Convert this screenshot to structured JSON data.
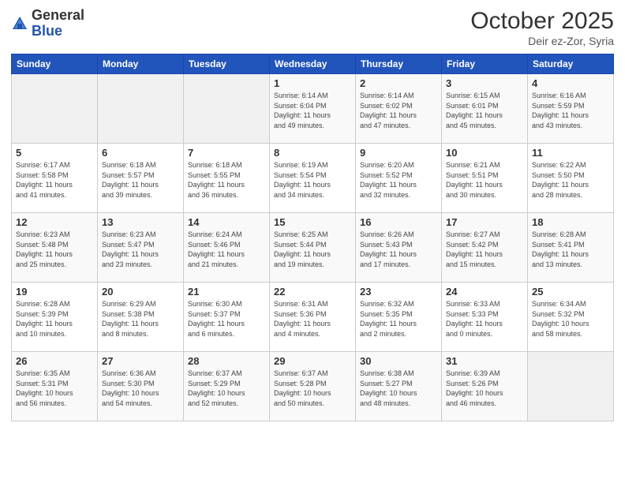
{
  "logo": {
    "general": "General",
    "blue": "Blue"
  },
  "header": {
    "month": "October 2025",
    "location": "Deir ez-Zor, Syria"
  },
  "weekdays": [
    "Sunday",
    "Monday",
    "Tuesday",
    "Wednesday",
    "Thursday",
    "Friday",
    "Saturday"
  ],
  "weeks": [
    [
      {
        "day": "",
        "info": ""
      },
      {
        "day": "",
        "info": ""
      },
      {
        "day": "",
        "info": ""
      },
      {
        "day": "1",
        "info": "Sunrise: 6:14 AM\nSunset: 6:04 PM\nDaylight: 11 hours\nand 49 minutes."
      },
      {
        "day": "2",
        "info": "Sunrise: 6:14 AM\nSunset: 6:02 PM\nDaylight: 11 hours\nand 47 minutes."
      },
      {
        "day": "3",
        "info": "Sunrise: 6:15 AM\nSunset: 6:01 PM\nDaylight: 11 hours\nand 45 minutes."
      },
      {
        "day": "4",
        "info": "Sunrise: 6:16 AM\nSunset: 5:59 PM\nDaylight: 11 hours\nand 43 minutes."
      }
    ],
    [
      {
        "day": "5",
        "info": "Sunrise: 6:17 AM\nSunset: 5:58 PM\nDaylight: 11 hours\nand 41 minutes."
      },
      {
        "day": "6",
        "info": "Sunrise: 6:18 AM\nSunset: 5:57 PM\nDaylight: 11 hours\nand 39 minutes."
      },
      {
        "day": "7",
        "info": "Sunrise: 6:18 AM\nSunset: 5:55 PM\nDaylight: 11 hours\nand 36 minutes."
      },
      {
        "day": "8",
        "info": "Sunrise: 6:19 AM\nSunset: 5:54 PM\nDaylight: 11 hours\nand 34 minutes."
      },
      {
        "day": "9",
        "info": "Sunrise: 6:20 AM\nSunset: 5:52 PM\nDaylight: 11 hours\nand 32 minutes."
      },
      {
        "day": "10",
        "info": "Sunrise: 6:21 AM\nSunset: 5:51 PM\nDaylight: 11 hours\nand 30 minutes."
      },
      {
        "day": "11",
        "info": "Sunrise: 6:22 AM\nSunset: 5:50 PM\nDaylight: 11 hours\nand 28 minutes."
      }
    ],
    [
      {
        "day": "12",
        "info": "Sunrise: 6:23 AM\nSunset: 5:48 PM\nDaylight: 11 hours\nand 25 minutes."
      },
      {
        "day": "13",
        "info": "Sunrise: 6:23 AM\nSunset: 5:47 PM\nDaylight: 11 hours\nand 23 minutes."
      },
      {
        "day": "14",
        "info": "Sunrise: 6:24 AM\nSunset: 5:46 PM\nDaylight: 11 hours\nand 21 minutes."
      },
      {
        "day": "15",
        "info": "Sunrise: 6:25 AM\nSunset: 5:44 PM\nDaylight: 11 hours\nand 19 minutes."
      },
      {
        "day": "16",
        "info": "Sunrise: 6:26 AM\nSunset: 5:43 PM\nDaylight: 11 hours\nand 17 minutes."
      },
      {
        "day": "17",
        "info": "Sunrise: 6:27 AM\nSunset: 5:42 PM\nDaylight: 11 hours\nand 15 minutes."
      },
      {
        "day": "18",
        "info": "Sunrise: 6:28 AM\nSunset: 5:41 PM\nDaylight: 11 hours\nand 13 minutes."
      }
    ],
    [
      {
        "day": "19",
        "info": "Sunrise: 6:28 AM\nSunset: 5:39 PM\nDaylight: 11 hours\nand 10 minutes."
      },
      {
        "day": "20",
        "info": "Sunrise: 6:29 AM\nSunset: 5:38 PM\nDaylight: 11 hours\nand 8 minutes."
      },
      {
        "day": "21",
        "info": "Sunrise: 6:30 AM\nSunset: 5:37 PM\nDaylight: 11 hours\nand 6 minutes."
      },
      {
        "day": "22",
        "info": "Sunrise: 6:31 AM\nSunset: 5:36 PM\nDaylight: 11 hours\nand 4 minutes."
      },
      {
        "day": "23",
        "info": "Sunrise: 6:32 AM\nSunset: 5:35 PM\nDaylight: 11 hours\nand 2 minutes."
      },
      {
        "day": "24",
        "info": "Sunrise: 6:33 AM\nSunset: 5:33 PM\nDaylight: 11 hours\nand 0 minutes."
      },
      {
        "day": "25",
        "info": "Sunrise: 6:34 AM\nSunset: 5:32 PM\nDaylight: 10 hours\nand 58 minutes."
      }
    ],
    [
      {
        "day": "26",
        "info": "Sunrise: 6:35 AM\nSunset: 5:31 PM\nDaylight: 10 hours\nand 56 minutes."
      },
      {
        "day": "27",
        "info": "Sunrise: 6:36 AM\nSunset: 5:30 PM\nDaylight: 10 hours\nand 54 minutes."
      },
      {
        "day": "28",
        "info": "Sunrise: 6:37 AM\nSunset: 5:29 PM\nDaylight: 10 hours\nand 52 minutes."
      },
      {
        "day": "29",
        "info": "Sunrise: 6:37 AM\nSunset: 5:28 PM\nDaylight: 10 hours\nand 50 minutes."
      },
      {
        "day": "30",
        "info": "Sunrise: 6:38 AM\nSunset: 5:27 PM\nDaylight: 10 hours\nand 48 minutes."
      },
      {
        "day": "31",
        "info": "Sunrise: 6:39 AM\nSunset: 5:26 PM\nDaylight: 10 hours\nand 46 minutes."
      },
      {
        "day": "",
        "info": ""
      }
    ]
  ]
}
